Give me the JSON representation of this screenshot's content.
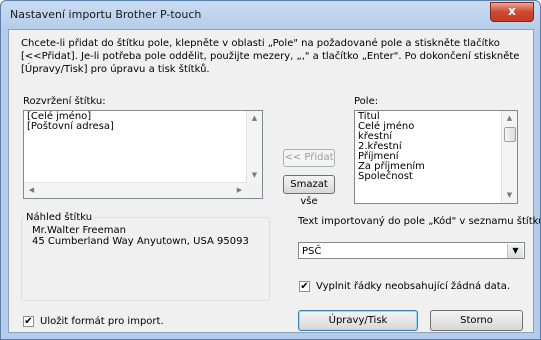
{
  "window": {
    "title": "Nastavení importu Brother P-touch",
    "close_glyph": "x"
  },
  "instruction": "Chcete-li přidat do štítku pole, klepněte v oblasti „Pole\" na požadované pole a stiskněte tlačítko [<<Přidat]. Je-li potřeba pole oddělit, použijte mezery, „,\" a tlačítko „Enter\". Po dokončení stiskněte [Úpravy/Tisk] pro úpravu a tisk štítků.",
  "layout_panel": {
    "label": "Rozvržení štítku:",
    "items": [
      "[Celé jméno]",
      "[Poštovní adresa]"
    ]
  },
  "fields_panel": {
    "label": "Pole:",
    "items": [
      "Titul",
      "Celé jméno",
      "křestní",
      "2.křestní",
      "Příjmení",
      "Za příjmením",
      "Společnost"
    ]
  },
  "buttons": {
    "add": "<< Přidat",
    "clear_all": "Smazat vše",
    "edit_print": "Úpravy/Tisk",
    "cancel": "Storno"
  },
  "preview": {
    "title": "Náhled štítku",
    "lines": [
      "Mr.Walter Freeman",
      "45 Cumberland Way Anyutown, USA 95093"
    ]
  },
  "code_field": {
    "label": "Text importovaný do pole „Kód\" v seznamu štítků:",
    "selected": "PSČ"
  },
  "checkboxes": {
    "fill_empty_label": "Vyplnit řádky neobsahující žádná data.",
    "fill_empty_checked": true,
    "save_format_label": "Uložit formát pro import.",
    "save_format_checked": true
  },
  "glyphs": {
    "check": "✔",
    "up": "▲",
    "down": "▼",
    "left": "◀",
    "right": "▶"
  }
}
